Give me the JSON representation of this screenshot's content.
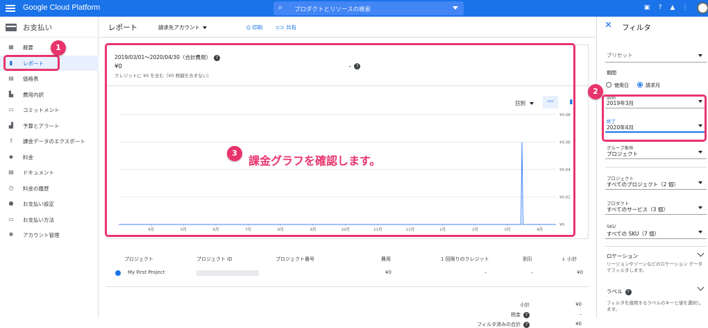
{
  "topbar": {
    "brand": "Google Cloud Platform",
    "search_placeholder": "プロダクトとリソースの検索"
  },
  "sidebar": {
    "title": "お支払い",
    "items": [
      {
        "label": "概要",
        "icon": "dashboard-icon"
      },
      {
        "label": "レポート",
        "icon": "bar-chart-icon",
        "active": true
      },
      {
        "label": "価格表",
        "icon": "table-icon"
      },
      {
        "label": "費用内訳",
        "icon": "waterfall-icon"
      },
      {
        "label": "コミットメント",
        "icon": "commitment-icon"
      },
      {
        "label": "予算とアラート",
        "icon": "budget-icon"
      },
      {
        "label": "課金データのエクスポート",
        "icon": "export-icon"
      },
      {
        "label": "料金",
        "icon": "tag-icon"
      },
      {
        "label": "ドキュメント",
        "icon": "document-icon"
      },
      {
        "label": "料金の履歴",
        "icon": "history-icon"
      },
      {
        "label": "お支払い設定",
        "icon": "person-icon"
      },
      {
        "label": "お支払い方法",
        "icon": "credit-card-icon"
      },
      {
        "label": "アカウント管理",
        "icon": "gear-icon"
      }
    ]
  },
  "toolbar": {
    "title": "レポート",
    "account": "請求先アカウント",
    "print": "印刷",
    "share": "共有"
  },
  "summary": {
    "range": "2019/03/01～2020/04/30（合計費用）",
    "amount": "¥0",
    "credit_note": "クレジットに ¥0 を含む（¥0 税額を含まない）",
    "dash": "–"
  },
  "graph": {
    "granularity": "日別"
  },
  "chart_data": {
    "type": "line",
    "x": [
      "4月",
      "5月",
      "6月",
      "7月",
      "8月",
      "9月",
      "10月",
      "11月",
      "12月",
      "1月",
      "2月",
      "3月",
      "4月"
    ],
    "y_tick_labels": [
      "¥0",
      "¥0.02",
      "¥0.04",
      "¥0.06",
      "¥0.08"
    ],
    "ylim": [
      0,
      0.08
    ],
    "series": [
      {
        "values": [
          0,
          0,
          0,
          0,
          0,
          0,
          0,
          0,
          0,
          0,
          0,
          0.06,
          0
        ]
      }
    ],
    "spike_position": 11.45,
    "grid": true
  },
  "table": {
    "headers": [
      "プロジェクト",
      "プロジェクト ID",
      "プロジェクト番号",
      "費用",
      "1 回限りのクレジット",
      "割引",
      "小計"
    ],
    "row": {
      "project": "My First Project",
      "cost": "¥0",
      "credit": "–",
      "discount": "–",
      "subtotal": "¥0"
    },
    "footer": [
      {
        "label": "小計",
        "value": "¥0"
      },
      {
        "label": "税金",
        "value": "–"
      },
      {
        "label": "フィルタ済みの合計",
        "value": "¥0"
      }
    ]
  },
  "filter": {
    "title": "フィルタ",
    "preset": "プリセット",
    "period_label": "期間",
    "radio_usage": "使用日",
    "radio_invoice": "請求月",
    "start_label": "開始",
    "start_value": "2019年3月",
    "end_label": "終了",
    "end_value": "2020年4月",
    "group_label": "グループ条件",
    "group_value": "プロジェクト",
    "project_label": "プロジェクト",
    "project_value": "すべてのプロジェクト（2 個）",
    "product_label": "プロダクト",
    "product_value": "すべてのサービス（3 個）",
    "sku_label": "SKU",
    "sku_value": "すべての SKU（7 個）",
    "location_label": "ロケーション",
    "location_desc": "リージョンやゾーンなどのロケーション データでフィルタします。",
    "labels_label": "ラベル",
    "labels_desc": "フィルタを適用するラベルのキーと値を選択します。"
  },
  "annotations": {
    "badge1": "1",
    "badge2": "2",
    "badge3": "3",
    "callout": "課金グラフを確認します。",
    "highlight_color": "#e8336c"
  },
  "colors": {
    "accent": "#1a73e8",
    "series": "#4285f4"
  }
}
